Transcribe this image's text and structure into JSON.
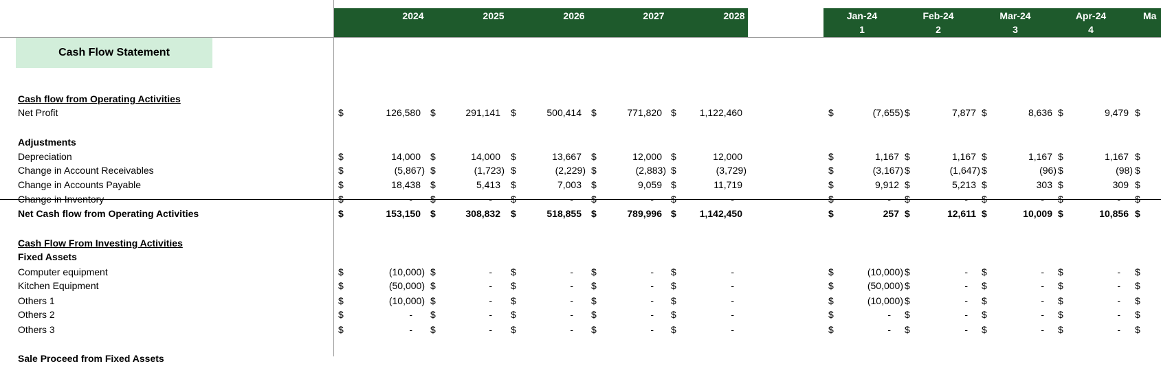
{
  "header": {
    "years": [
      "2024",
      "2025",
      "2026",
      "2027",
      "2028"
    ],
    "months": [
      {
        "label": "Jan-24",
        "index": "1"
      },
      {
        "label": "Feb-24",
        "index": "2"
      },
      {
        "label": "Mar-24",
        "index": "3"
      },
      {
        "label": "Apr-24",
        "index": "4"
      },
      {
        "label": "Ma",
        "index": ""
      }
    ]
  },
  "title": "Cash Flow Statement",
  "colors": {
    "header_green": "#1e5a2c",
    "title_fill": "#d2eeda"
  },
  "currency_symbol": "$",
  "rows": [
    {
      "label": "Cash flow from Operating Activities",
      "style": "section",
      "annual": null,
      "monthly": null
    },
    {
      "label": "Net Profit",
      "style": "normal",
      "annual": [
        "126,580",
        "291,141",
        "500,414",
        "771,820",
        "1,122,460"
      ],
      "monthly": [
        "(7,655)",
        "7,877",
        "8,636",
        "9,479",
        ""
      ]
    },
    {
      "label": "",
      "style": "blank",
      "annual": null,
      "monthly": null
    },
    {
      "label": "Adjustments",
      "style": "bold",
      "annual": null,
      "monthly": null
    },
    {
      "label": "Depreciation",
      "style": "normal",
      "annual": [
        "14,000",
        "14,000",
        "13,667",
        "12,000",
        "12,000"
      ],
      "monthly": [
        "1,167",
        "1,167",
        "1,167",
        "1,167",
        ""
      ]
    },
    {
      "label": "Change in Account Receivables",
      "style": "normal",
      "annual": [
        "(5,867)",
        "(1,723)",
        "(2,229)",
        "(2,883)",
        "(3,729)"
      ],
      "monthly": [
        "(3,167)",
        "(1,647)",
        "(96)",
        "(98)",
        ""
      ]
    },
    {
      "label": "Change in Accounts Payable",
      "style": "normal",
      "annual": [
        "18,438",
        "5,413",
        "7,003",
        "9,059",
        "11,719"
      ],
      "monthly": [
        "9,912",
        "5,213",
        "303",
        "309",
        ""
      ]
    },
    {
      "label": "Change in Inventory",
      "style": "normal",
      "annual": [
        "-",
        "-",
        "-",
        "-",
        "-"
      ],
      "monthly": [
        "-",
        "-",
        "-",
        "-",
        ""
      ]
    },
    {
      "label": "Net Cash flow from Operating Activities",
      "style": "total",
      "annual": [
        "153,150",
        "308,832",
        "518,855",
        "789,996",
        "1,142,450"
      ],
      "monthly": [
        "257",
        "12,611",
        "10,009",
        "10,856",
        ""
      ]
    },
    {
      "label": "",
      "style": "blank",
      "annual": null,
      "monthly": null
    },
    {
      "label": "Cash Flow From Investing Activities",
      "style": "section",
      "annual": null,
      "monthly": null
    },
    {
      "label": "Fixed Assets",
      "style": "bold",
      "annual": null,
      "monthly": null
    },
    {
      "label": "Computer equipment",
      "style": "normal",
      "annual": [
        "(10,000)",
        "-",
        "-",
        "-",
        "-"
      ],
      "monthly": [
        "(10,000)",
        "-",
        "-",
        "-",
        ""
      ]
    },
    {
      "label": "Kitchen Equipment",
      "style": "normal",
      "annual": [
        "(50,000)",
        "-",
        "-",
        "-",
        "-"
      ],
      "monthly": [
        "(50,000)",
        "-",
        "-",
        "-",
        ""
      ]
    },
    {
      "label": "Others 1",
      "style": "normal",
      "annual": [
        "(10,000)",
        "-",
        "-",
        "-",
        "-"
      ],
      "monthly": [
        "(10,000)",
        "-",
        "-",
        "-",
        ""
      ]
    },
    {
      "label": "Others 2",
      "style": "normal",
      "annual": [
        "-",
        "-",
        "-",
        "-",
        "-"
      ],
      "monthly": [
        "-",
        "-",
        "-",
        "-",
        ""
      ]
    },
    {
      "label": "Others 3",
      "style": "normal",
      "annual": [
        "-",
        "-",
        "-",
        "-",
        "-"
      ],
      "monthly": [
        "-",
        "-",
        "-",
        "-",
        ""
      ]
    },
    {
      "label": "",
      "style": "blank",
      "annual": null,
      "monthly": null
    },
    {
      "label": "Sale Proceed from Fixed Assets",
      "style": "bold",
      "annual": null,
      "monthly": null
    }
  ]
}
